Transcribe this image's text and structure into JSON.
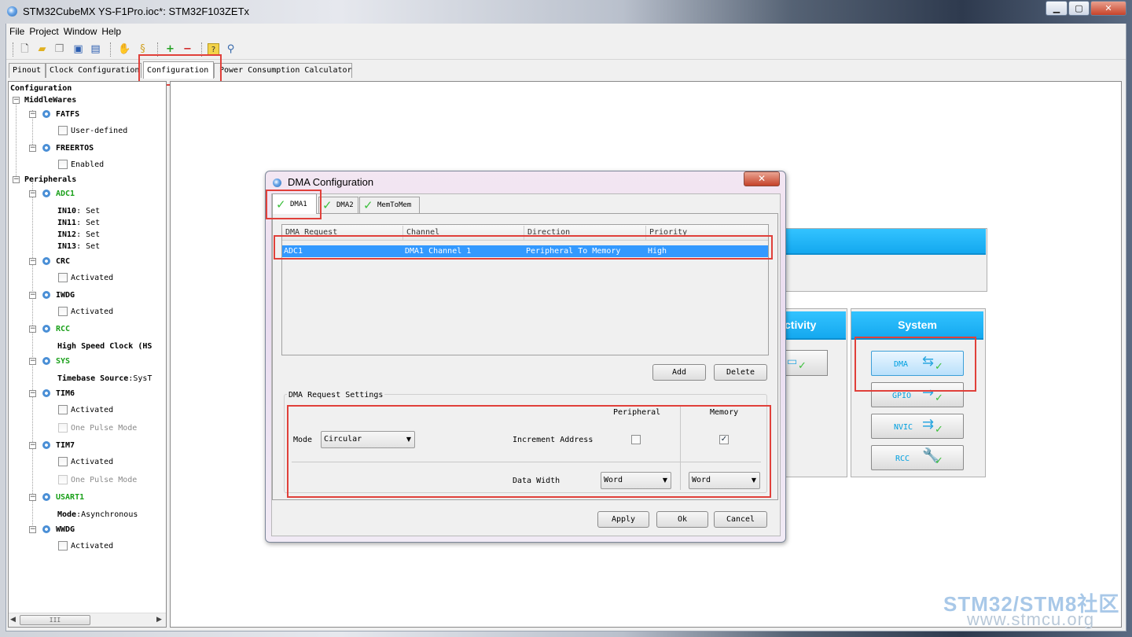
{
  "window": {
    "title": "STM32CubeMX YS-F1Pro.ioc*: STM32F103ZETx",
    "controls": [
      "▁",
      "▢",
      "✕"
    ]
  },
  "menu": [
    "File",
    "Project",
    "Window",
    "Help"
  ],
  "toolbar": {
    "icons": [
      "new-file-icon",
      "open-folder-icon",
      "copy-icon",
      "save-icon",
      "save-all-icon",
      "import-icon",
      "generate-report-icon",
      "zoom-in-icon",
      "zoom-out-icon",
      "help-icon",
      "key-icon"
    ]
  },
  "tabs": [
    "Pinout",
    "Clock Configuration",
    "Configuration",
    "Power Consumption Calculator"
  ],
  "active_tab": "Configuration",
  "tree": {
    "root": "Configuration",
    "middlewares": {
      "label": "MiddleWares",
      "fatfs": {
        "name": "FATFS",
        "option": "User-defined",
        "checked": false
      },
      "freertos": {
        "name": "FREERTOS",
        "option": "Enabled",
        "checked": false
      }
    },
    "peripherals": {
      "label": "Peripherals",
      "adc1": {
        "name": "ADC1",
        "params": [
          {
            "k": "IN10",
            "v": ": Set"
          },
          {
            "k": "IN11",
            "v": ": Set"
          },
          {
            "k": "IN12",
            "v": ": Set"
          },
          {
            "k": "IN13",
            "v": ": Set"
          }
        ]
      },
      "crc": {
        "name": "CRC",
        "option": "Activated"
      },
      "iwdg": {
        "name": "IWDG",
        "option": "Activated"
      },
      "rcc": {
        "name": "RCC",
        "param": "High Speed Clock (HS"
      },
      "sys": {
        "name": "SYS",
        "param_k": "Timebase Source",
        "param_v": ":SysT"
      },
      "tim6": {
        "name": "TIM6",
        "option1": "Activated",
        "option2": "One Pulse Mode"
      },
      "tim7": {
        "name": "TIM7",
        "option1": "Activated",
        "option2": "One Pulse Mode"
      },
      "usart1": {
        "name": "USART1",
        "param_k": "Mode",
        "param_v": ":Asynchronous"
      },
      "wwdg": {
        "name": "WWDG",
        "option": "Activated"
      }
    }
  },
  "scroll_thumb": "III",
  "panels": {
    "connectivity_head": "ctivity",
    "system_head": "System",
    "system_buttons": [
      {
        "label": "DMA",
        "icon": "dma-icon"
      },
      {
        "label": "GPIO",
        "icon": "gpio-icon"
      },
      {
        "label": "NVIC",
        "icon": "nvic-icon"
      },
      {
        "label": "RCC",
        "icon": "wrench-icon"
      }
    ]
  },
  "dialog": {
    "title": "DMA Configuration",
    "close": "✕",
    "tabs": [
      "DMA1",
      "DMA2",
      "MemToMem"
    ],
    "active_tab": "DMA1",
    "columns": [
      "DMA Request",
      "Channel",
      "Direction",
      "Priority"
    ],
    "rows": [
      {
        "request": "ADC1",
        "channel": "DMA1 Channel 1",
        "direction": "Peripheral To Memory",
        "priority": "High"
      }
    ],
    "add": "Add",
    "delete": "Delete",
    "settings": {
      "legend": "DMA Request Settings",
      "peripheral_col": "Peripheral",
      "memory_col": "Memory",
      "mode_label": "Mode",
      "mode_value": "Circular",
      "increment_label": "Increment Address",
      "peripheral_increment": false,
      "memory_increment": true,
      "width_label": "Data Width",
      "peripheral_width": "Word",
      "memory_width": "Word"
    },
    "apply": "Apply",
    "ok": "Ok",
    "cancel": "Cancel"
  },
  "watermark": {
    "line1": "STM32/STM8社区",
    "line2": "www.stmcu.org"
  }
}
